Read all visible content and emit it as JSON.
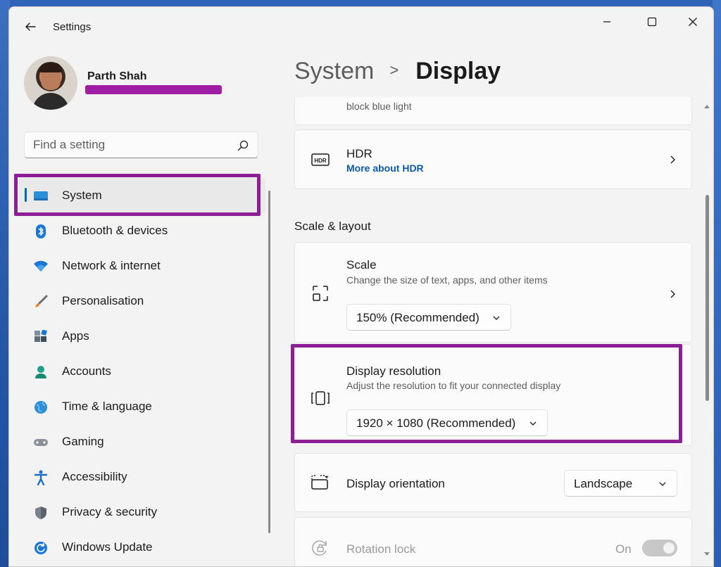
{
  "window": {
    "app_title": "Settings"
  },
  "profile": {
    "name": "Parth Shah"
  },
  "search": {
    "placeholder": "Find a setting"
  },
  "sidebar": {
    "items": [
      {
        "label": "System",
        "icon": "system-icon",
        "active": true
      },
      {
        "label": "Bluetooth & devices",
        "icon": "bluetooth-icon"
      },
      {
        "label": "Network & internet",
        "icon": "wifi-icon"
      },
      {
        "label": "Personalisation",
        "icon": "brush-icon"
      },
      {
        "label": "Apps",
        "icon": "apps-icon"
      },
      {
        "label": "Accounts",
        "icon": "accounts-icon"
      },
      {
        "label": "Time & language",
        "icon": "globe-icon"
      },
      {
        "label": "Gaming",
        "icon": "gamepad-icon"
      },
      {
        "label": "Accessibility",
        "icon": "accessibility-icon"
      },
      {
        "label": "Privacy & security",
        "icon": "shield-icon"
      },
      {
        "label": "Windows Update",
        "icon": "update-icon"
      }
    ]
  },
  "breadcrumb": {
    "parent": "System",
    "separator": ">",
    "current": "Display"
  },
  "content": {
    "night_light_partial_sub": "block blue light",
    "hdr": {
      "title": "HDR",
      "link": "More about HDR"
    },
    "section_scale_layout": "Scale & layout",
    "scale": {
      "title": "Scale",
      "subtitle": "Change the size of text, apps, and other items",
      "value": "150% (Recommended)"
    },
    "resolution": {
      "title": "Display resolution",
      "subtitle": "Adjust the resolution to fit your connected display",
      "value": "1920 × 1080 (Recommended)"
    },
    "orientation": {
      "title": "Display orientation",
      "value": "Landscape"
    },
    "rotation_lock": {
      "title": "Rotation lock",
      "state": "On",
      "enabled": false
    }
  },
  "colors": {
    "accent": "#0067c0",
    "highlight_annotation": "#8c1f93",
    "link": "#0a5aa8"
  }
}
